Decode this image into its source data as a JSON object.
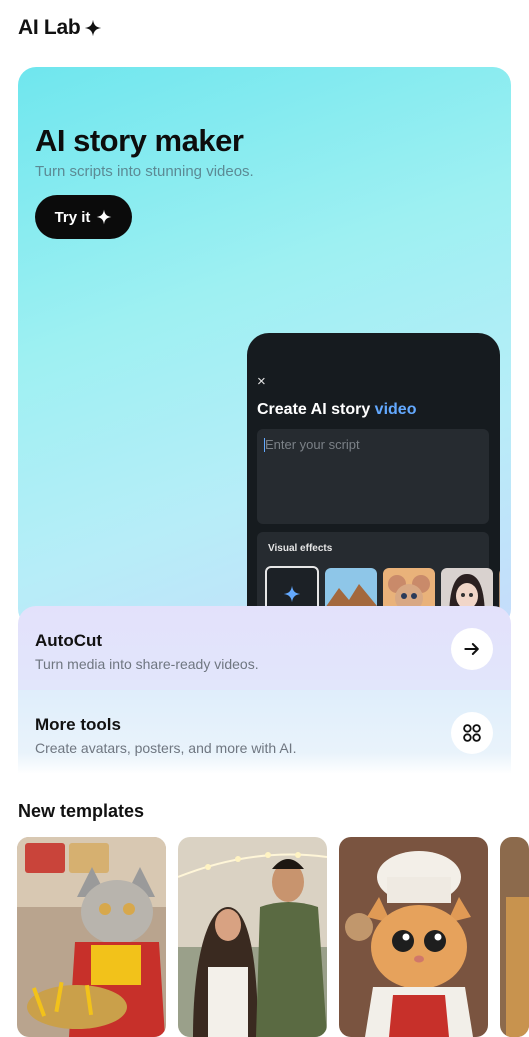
{
  "app": {
    "title": "AI Lab",
    "title_icon": "sparkle-icon"
  },
  "hero": {
    "title": "AI story maker",
    "subtitle": "Turn scripts into stunning videos.",
    "cta_label": "Try it",
    "preview": {
      "close_glyph": "×",
      "title_prefix": "Create AI story ",
      "title_accent": "video",
      "script_placeholder": "Enter your script",
      "effects_label": "Visual effects",
      "effects_thumbs": [
        "ai-magic-icon",
        "mountain-landscape",
        "cartoon-mouse-character",
        "anime-girl-portrait",
        "partial-thumbnail"
      ]
    }
  },
  "tools": [
    {
      "title": "AutoCut",
      "subtitle": "Turn media into share-ready videos.",
      "icon": "arrow-right-icon"
    },
    {
      "title": "More tools",
      "subtitle": "Create avatars, posters, and more with AI.",
      "icon": "grid-four-circles-icon"
    }
  ],
  "templates": {
    "title": "New templates",
    "items": [
      {
        "image": "cat-eating-fries-at-fast-food-counter"
      },
      {
        "image": "couple-looking-at-each-other-outdoors"
      },
      {
        "image": "cartoon-cat-chef"
      },
      {
        "image": "partial-template-thumbnail"
      }
    ]
  },
  "colors": {
    "accent": "#63a9ff",
    "cta_bg": "#0b0b0b"
  }
}
